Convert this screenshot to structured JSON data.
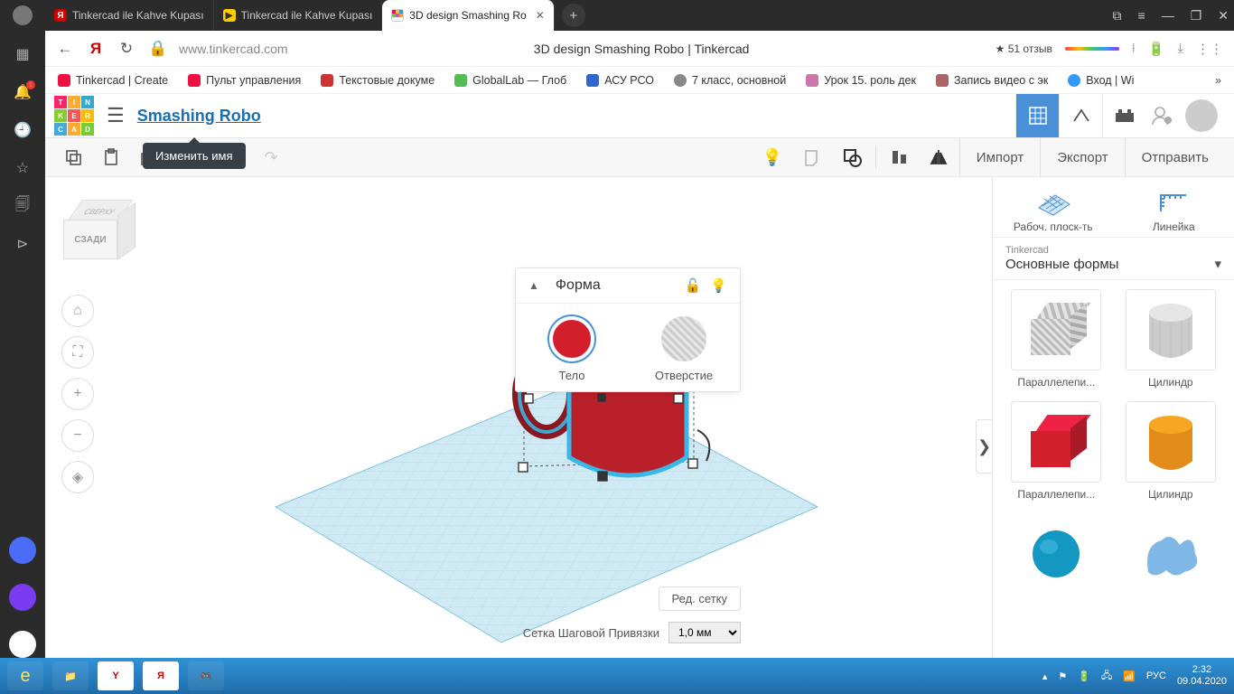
{
  "os": {
    "tabs": [
      {
        "label": "Tinkercad ile Kahve Kupası",
        "fav_bg": "#cc0000",
        "fav_txt": "Я"
      },
      {
        "label": "Tinkercad ile Kahve Kupası",
        "fav_bg": "#ffcc00",
        "fav_txt": "▶"
      },
      {
        "label": "3D design Smashing Ro",
        "fav_bg": "#ffffff",
        "fav_txt": ""
      }
    ],
    "win_controls": {
      "min": "—",
      "max": "❐",
      "close": "✕"
    }
  },
  "browser": {
    "url": "www.tinkercad.com",
    "page_title": "3D design Smashing Robo | Tinkercad",
    "rating": "★ 51 отзыв",
    "bookmarks": [
      {
        "label": "Tinkercad | Create",
        "color": "#e14"
      },
      {
        "label": "Пульт управления",
        "color": "#e14"
      },
      {
        "label": "Текстовые докуме",
        "color": "#c33"
      },
      {
        "label": "GlobalLab — Глоб",
        "color": "#5b5"
      },
      {
        "label": "АСУ РСО",
        "color": "#36c"
      },
      {
        "label": "7 класс, основной",
        "color": "#888"
      },
      {
        "label": "Урок 15. роль дек",
        "color": "#c7a"
      },
      {
        "label": "Запись видео с эк",
        "color": "#a66"
      },
      {
        "label": "Вход | Wi",
        "color": "#39f"
      }
    ]
  },
  "app": {
    "design_name": "Smashing Robo",
    "tooltip": "Изменить имя",
    "top_right": {
      "import": "Импорт",
      "export": "Экспорт",
      "send": "Отправить"
    },
    "viewcube": {
      "top": "СВЕРХУ",
      "front": "СЗАДИ"
    },
    "shape_panel": {
      "title": "Форма",
      "solid": "Тело",
      "hole": "Отверстие"
    },
    "edit_grid": "Ред. сетку",
    "snap": {
      "label": "Сетка Шаговой Привязки",
      "value": "1,0 мм"
    },
    "sidebar": {
      "tool_workplane": "Рабоч. плоск-ть",
      "tool_ruler": "Линейка",
      "cat_sup": "Tinkercad",
      "cat": "Основные формы",
      "shapes": [
        {
          "label": "Параллелепи...",
          "type": "box-stripe"
        },
        {
          "label": "Цилиндр",
          "type": "cyl-stripe"
        },
        {
          "label": "Параллелепи...",
          "type": "box-red"
        },
        {
          "label": "Цилиндр",
          "type": "cyl-orange"
        },
        {
          "label": "",
          "type": "sphere-blue"
        },
        {
          "label": "",
          "type": "blob"
        }
      ]
    }
  },
  "taskbar": {
    "lang": "РУС",
    "time": "2:32",
    "date": "09.04.2020"
  }
}
